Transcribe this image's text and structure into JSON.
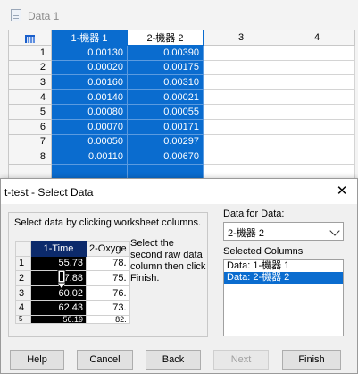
{
  "worksheet": {
    "title": "Data 1",
    "columns": [
      "1-機器 1",
      "2-機器 2",
      "3",
      "4"
    ],
    "rows": [
      {
        "num": "1",
        "c1": "0.00130",
        "c2": "0.00390"
      },
      {
        "num": "2",
        "c1": "0.00020",
        "c2": "0.00175"
      },
      {
        "num": "3",
        "c1": "0.00160",
        "c2": "0.00310"
      },
      {
        "num": "4",
        "c1": "0.00140",
        "c2": "0.00021"
      },
      {
        "num": "5",
        "c1": "0.00080",
        "c2": "0.00055"
      },
      {
        "num": "6",
        "c1": "0.00070",
        "c2": "0.00171"
      },
      {
        "num": "7",
        "c1": "0.00050",
        "c2": "0.00297"
      },
      {
        "num": "8",
        "c1": "0.00110",
        "c2": "0.00670"
      },
      {
        "num": "",
        "c1": "",
        "c2": ""
      }
    ]
  },
  "dialog": {
    "title": "t-test - Select Data",
    "instruction": "Select data by clicking worksheet columns.",
    "preview": {
      "columns": [
        "1-Time",
        "2-Oxyge"
      ],
      "rows": [
        {
          "num": "1",
          "v1": "55.73",
          "v2": "78."
        },
        {
          "num": "2",
          "v1": "57.88",
          "v2": "75."
        },
        {
          "num": "3",
          "v1": "60.02",
          "v2": "76."
        },
        {
          "num": "4",
          "v1": "62.43",
          "v2": "73."
        },
        {
          "num": "5",
          "v1": "56.19",
          "v2": "82."
        }
      ]
    },
    "hint": "Select the second raw data column then click Finish.",
    "data_for_data_label": "Data for Data:",
    "data_for_data_value": "2-機器 2",
    "selected_columns_label": "Selected Columns",
    "selected_columns": [
      {
        "label": "Data: 1-機器 1",
        "selected": false
      },
      {
        "label": "Data: 2-機器 2",
        "selected": true
      }
    ],
    "buttons": {
      "help": "Help",
      "cancel": "Cancel",
      "back": "Back",
      "next": "Next",
      "finish": "Finish"
    }
  }
}
